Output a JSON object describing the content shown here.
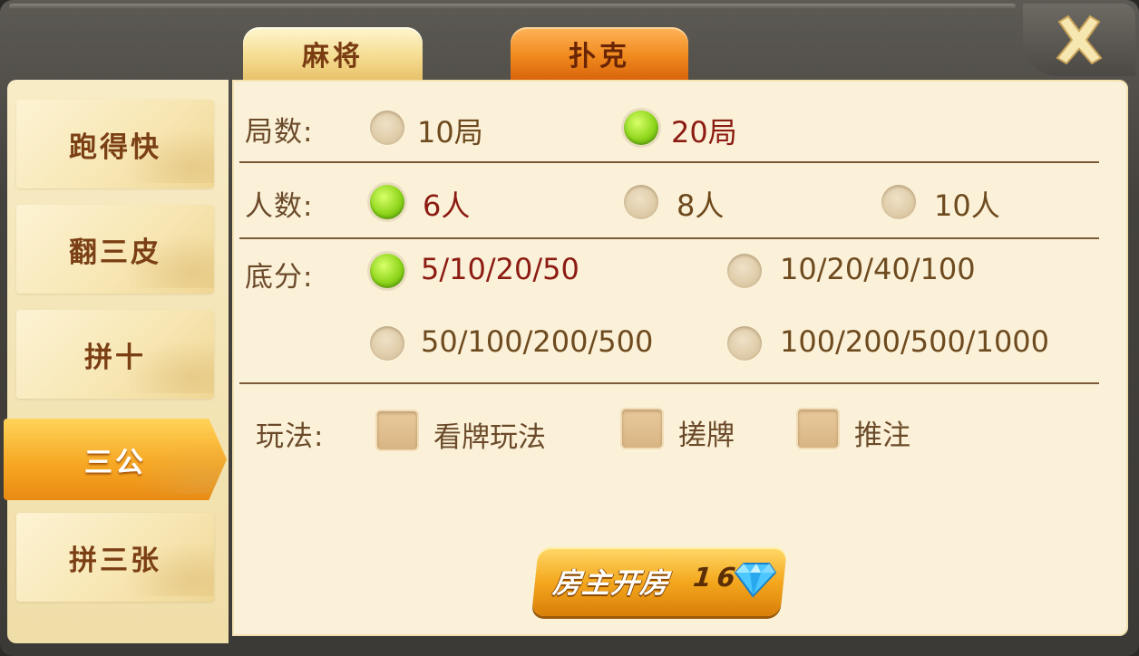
{
  "tabs": [
    {
      "label": "麻将",
      "active": false
    },
    {
      "label": "扑克",
      "active": true
    }
  ],
  "close_icon": "close-x-icon",
  "sidebar": {
    "items": [
      {
        "label": "跑得快",
        "active": false
      },
      {
        "label": "翻三皮",
        "active": false
      },
      {
        "label": "拼十",
        "active": false
      },
      {
        "label": "三公",
        "active": true
      },
      {
        "label": "拼三张",
        "active": false
      }
    ]
  },
  "rounds": {
    "label": "局数:",
    "options": [
      {
        "text": "10局",
        "selected": false
      },
      {
        "text": "20局",
        "selected": true
      }
    ]
  },
  "players": {
    "label": "人数:",
    "options": [
      {
        "text": "6人",
        "selected": true
      },
      {
        "text": "8人",
        "selected": false
      },
      {
        "text": "10人",
        "selected": false
      }
    ]
  },
  "base_score": {
    "label": "底分:",
    "options": [
      {
        "text": "5/10/20/50",
        "selected": true
      },
      {
        "text": "10/20/40/100",
        "selected": false
      },
      {
        "text": "50/100/200/500",
        "selected": false
      },
      {
        "text": "100/200/500/1000",
        "selected": false
      }
    ]
  },
  "play_mode": {
    "label": "玩法:",
    "options": [
      {
        "text": "看牌玩法",
        "checked": false
      },
      {
        "text": "搓牌",
        "checked": false
      },
      {
        "text": "推注",
        "checked": false
      }
    ]
  },
  "create_button": {
    "label": "房主开房",
    "cost": "16",
    "icon": "diamond-icon"
  },
  "colors": {
    "selected_radio": "#8fd61c",
    "selected_text": "#8c1b12",
    "active_tab": "#f08a1e",
    "active_sidebar": "#f7a824"
  }
}
